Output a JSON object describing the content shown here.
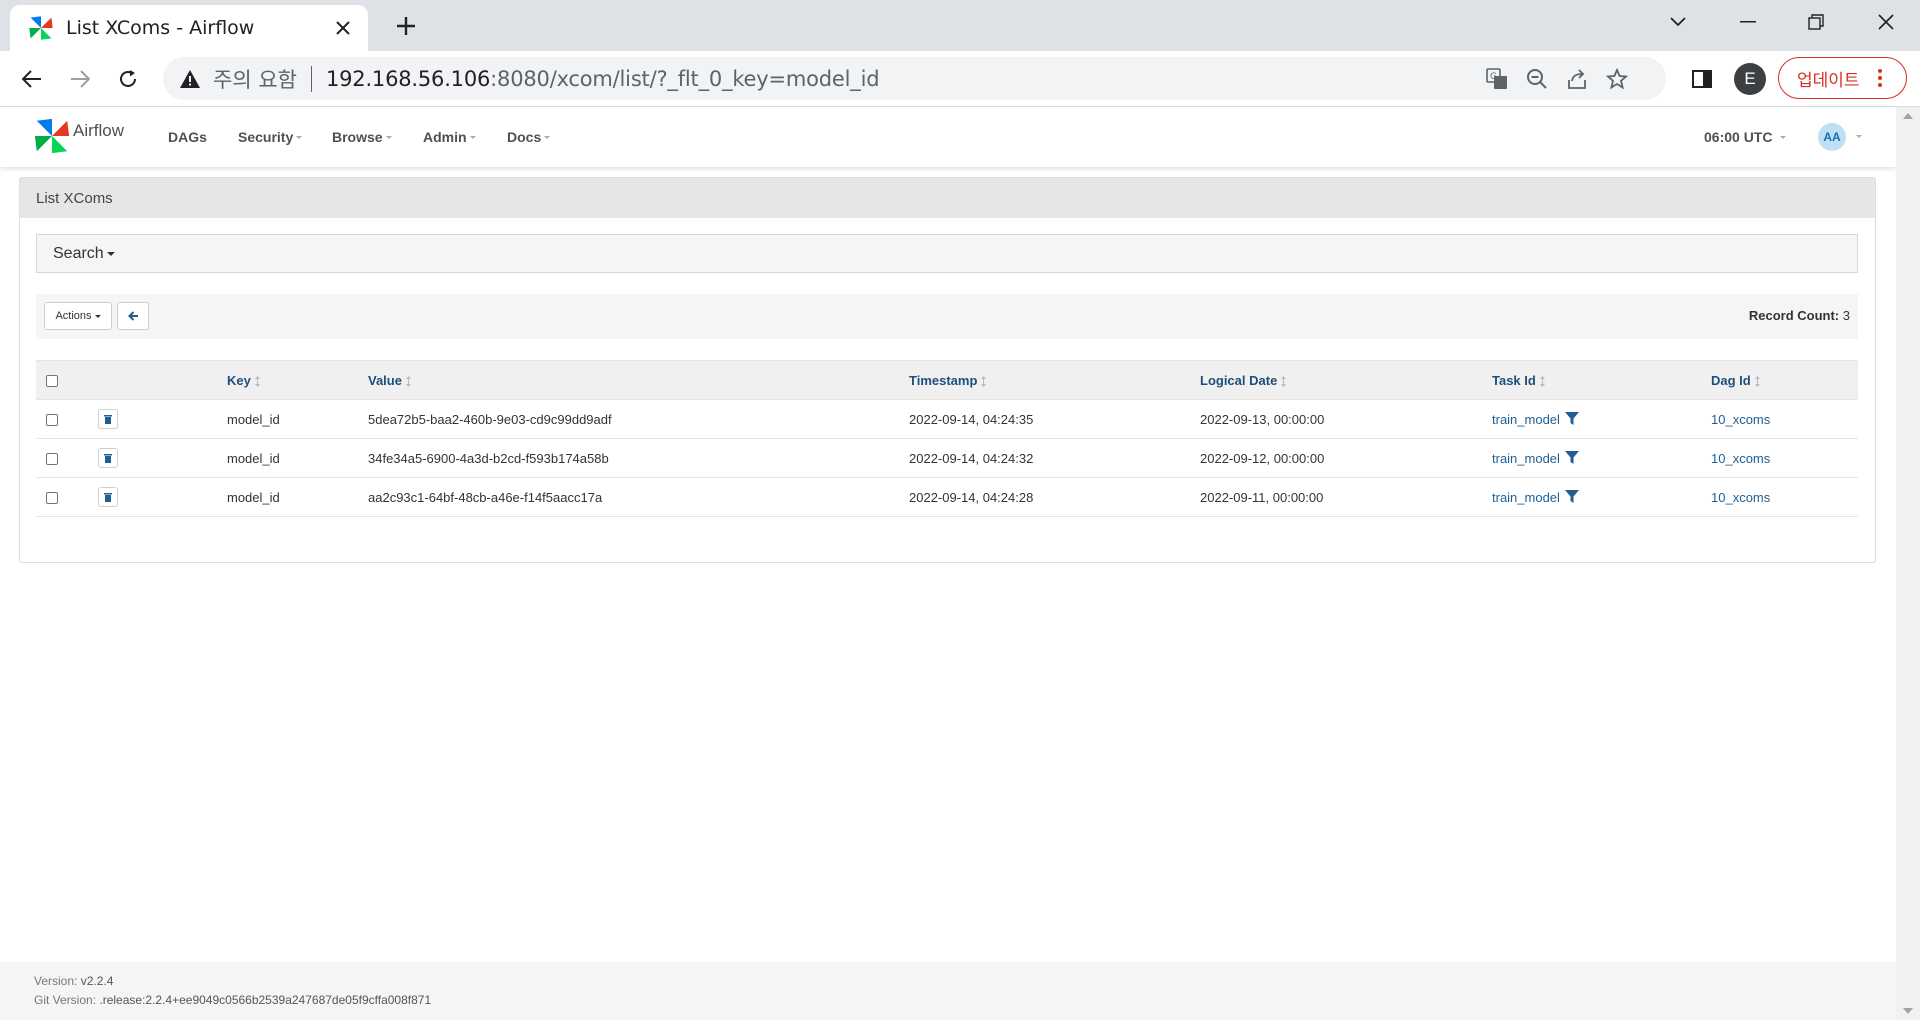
{
  "browser": {
    "tab_title": "List XComs - Airflow",
    "security_warning": "주의 요함",
    "url_host": "192.168.56.106",
    "url_rest": ":8080/xcom/list/?_flt_0_key=model_id",
    "profile_initial": "E",
    "update_label": "업데이트"
  },
  "navbar": {
    "brand": "Airflow",
    "menus": [
      "DAGs",
      "Security",
      "Browse",
      "Admin",
      "Docs"
    ],
    "time": "06:00 UTC",
    "user_initials": "AA"
  },
  "panel": {
    "title": "List XComs",
    "search_label": "Search",
    "actions_label": "Actions",
    "record_count_label": "Record Count:",
    "record_count_value": "3"
  },
  "table": {
    "headers": [
      "Key",
      "Value",
      "Timestamp",
      "Logical Date",
      "Task Id",
      "Dag Id"
    ],
    "rows": [
      {
        "key": "model_id",
        "value": "5dea72b5-baa2-460b-9e03-cd9c99dd9adf",
        "timestamp": "2022-09-14, 04:24:35",
        "logical_date": "2022-09-13, 00:00:00",
        "task_id": "train_model",
        "dag_id": "10_xcoms"
      },
      {
        "key": "model_id",
        "value": "34fe34a5-6900-4a3d-b2cd-f593b174a58b",
        "timestamp": "2022-09-14, 04:24:32",
        "logical_date": "2022-09-12, 00:00:00",
        "task_id": "train_model",
        "dag_id": "10_xcoms"
      },
      {
        "key": "model_id",
        "value": "aa2c93c1-64bf-48cb-a46e-f14f5aacc17a",
        "timestamp": "2022-09-14, 04:24:28",
        "logical_date": "2022-09-11, 00:00:00",
        "task_id": "train_model",
        "dag_id": "10_xcoms"
      }
    ]
  },
  "footer": {
    "version_label": "Version:",
    "version_value": "v2.2.4",
    "git_label": "Git Version:",
    "git_value": ".release:2.2.4+ee9049c0566b2539a247687de05f9cffa008f871"
  },
  "colors": {
    "accent_link": "#1f5f93",
    "header_text": "#1f4e7a",
    "update_red": "#d93025"
  }
}
